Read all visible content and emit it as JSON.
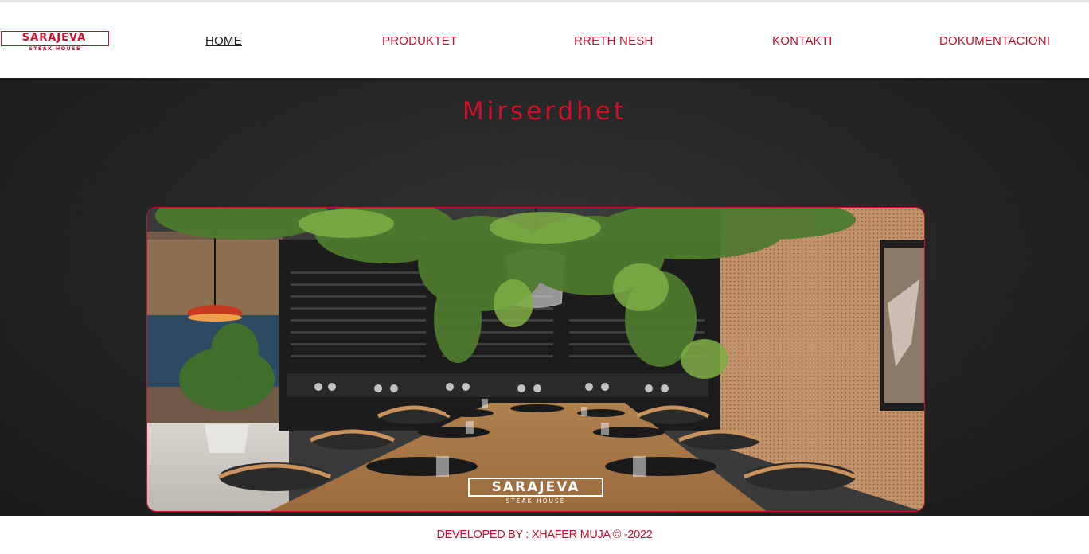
{
  "brand": {
    "name": "SARAJEVA",
    "tagline": "STEAK HOUSE"
  },
  "nav": {
    "items": [
      {
        "label": "HOME",
        "active": true
      },
      {
        "label": "PRODUKTET",
        "active": false
      },
      {
        "label": "RRETH NESH",
        "active": false
      },
      {
        "label": "KONTAKTI",
        "active": false
      },
      {
        "label": "DOKUMENTACIONI",
        "active": false
      }
    ]
  },
  "main": {
    "title": "Mirserdhet",
    "image": {
      "overlay_brand": "SARAJEVA",
      "overlay_tagline": "STEAK HOUSE"
    }
  },
  "footer": {
    "credit": "DEVELOPED BY : XHAFER MUJA © -2022"
  },
  "colors": {
    "accent": "#c8102e",
    "background": "#262626",
    "nav_active": "#222222"
  }
}
